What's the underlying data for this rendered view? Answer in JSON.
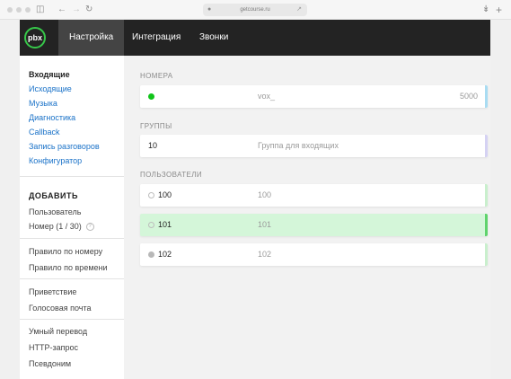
{
  "browser": {
    "url": "getcourse.ru",
    "icons": [
      "sidebar-icon",
      "back-icon",
      "forward-icon",
      "reload-icon",
      "lock-icon",
      "share-icon",
      "download-icon",
      "new-tab-icon"
    ]
  },
  "app": {
    "logo": "pbx",
    "tabs": [
      {
        "label": "Настройка",
        "active": true
      },
      {
        "label": "Интеграция",
        "active": false
      },
      {
        "label": "Звонки",
        "active": false
      }
    ]
  },
  "sidebar": {
    "links": [
      {
        "label": "Входящие",
        "active": true
      },
      {
        "label": "Исходящие"
      },
      {
        "label": "Музыка"
      },
      {
        "label": "Диагностика"
      },
      {
        "label": "Callback"
      },
      {
        "label": "Запись разговоров"
      },
      {
        "label": "Конфигуратор"
      }
    ],
    "add_heading": "ДОБАВИТЬ",
    "add_items": [
      {
        "label": "Пользователь"
      },
      {
        "label": "Номер (1 / 30)",
        "help": "?"
      },
      {
        "label": "Правило по номеру"
      },
      {
        "label": "Правило по времени"
      },
      {
        "label": "Приветствие"
      },
      {
        "label": "Голосовая почта"
      },
      {
        "label": "Умный перевод"
      },
      {
        "label": "HTTP-запрос"
      },
      {
        "label": "Псевдоним"
      }
    ]
  },
  "content": {
    "numbers": {
      "title": "НОМЕРА",
      "rows": [
        {
          "status": "green",
          "name": "vox_",
          "value": "5000",
          "bar_color": "#a9dcf2"
        }
      ]
    },
    "groups": {
      "title": "ГРУППЫ",
      "rows": [
        {
          "id": "10",
          "name": "Группа для входящих",
          "bar_color": "#d5d2f3"
        }
      ]
    },
    "users": {
      "title": "ПОЛЬЗОВАТЕЛИ",
      "rows": [
        {
          "status": "empty",
          "id": "100",
          "name": "100",
          "selected": false,
          "bar_color": "#c9efcd"
        },
        {
          "status": "empty",
          "id": "101",
          "name": "101",
          "selected": true,
          "bar_color": "#5fd36c"
        },
        {
          "status": "gray",
          "id": "102",
          "name": "102",
          "selected": false,
          "bar_color": "#c9efcd"
        }
      ]
    }
  }
}
